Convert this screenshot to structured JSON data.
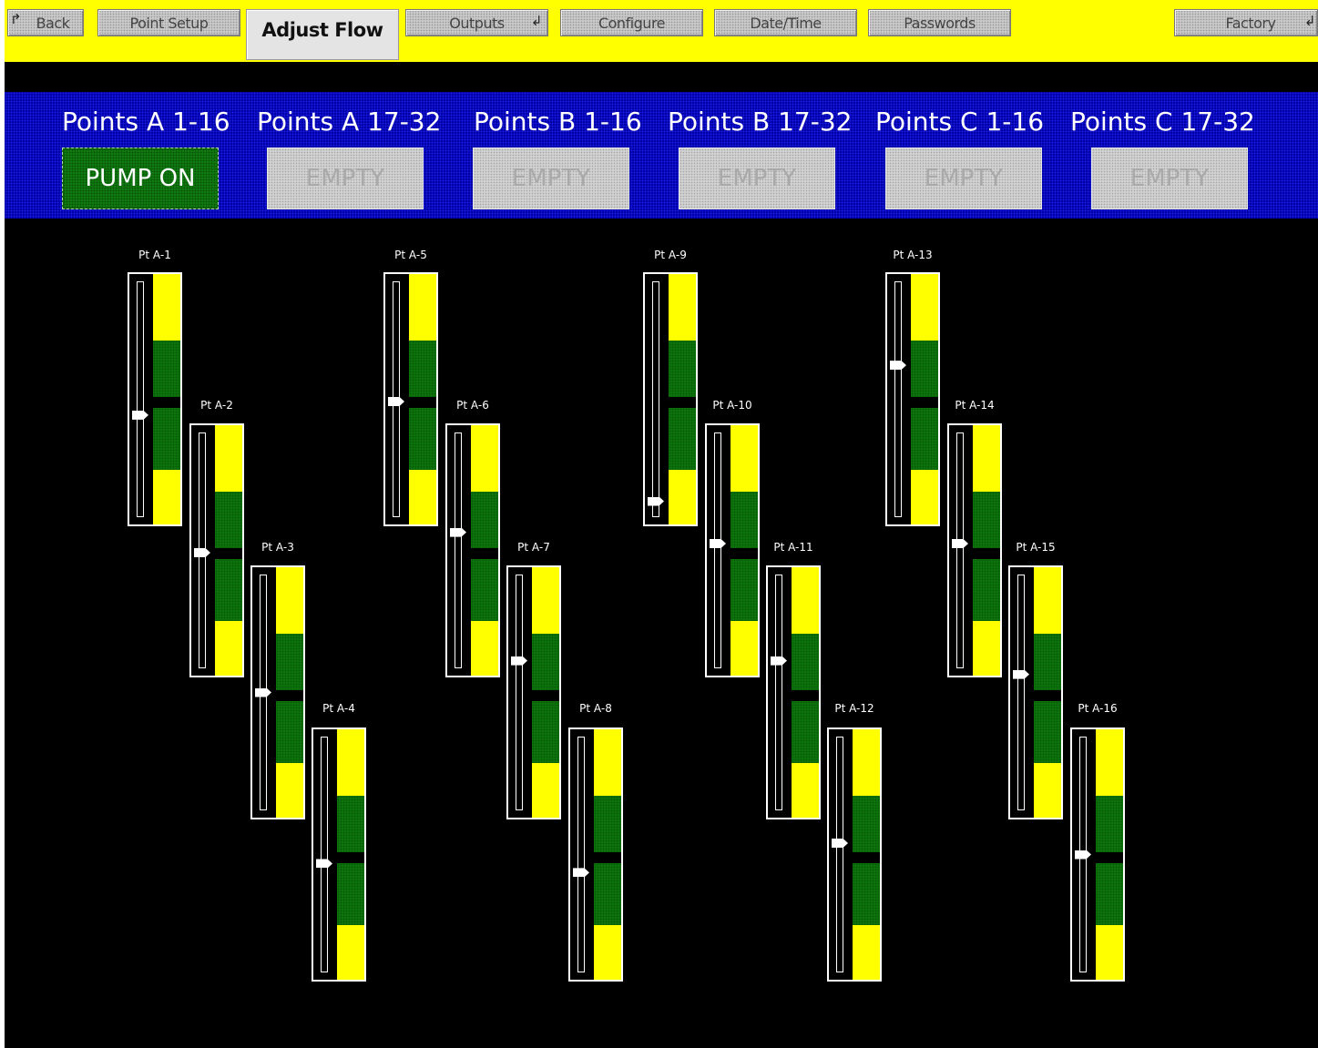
{
  "nav": {
    "back": "Back",
    "point_setup": "Point Setup",
    "adjust_flow": "Adjust Flow",
    "outputs": "Outputs",
    "configure": "Configure",
    "datetime": "Date/Time",
    "passwords": "Passwords",
    "factory": "Factory",
    "glyph_enter": "↲",
    "glyph_back": "↱"
  },
  "groups": [
    {
      "title": "Points A 1-16",
      "button": "PUMP ON",
      "state": "on"
    },
    {
      "title": "Points A 17-32",
      "button": "EMPTY",
      "state": "empty"
    },
    {
      "title": "Points B 1-16",
      "button": "EMPTY",
      "state": "empty"
    },
    {
      "title": "Points B 17-32",
      "button": "EMPTY",
      "state": "empty"
    },
    {
      "title": "Points C 1-16",
      "button": "EMPTY",
      "state": "empty"
    },
    {
      "title": "Points C 17-32",
      "button": "EMPTY",
      "state": "empty"
    }
  ],
  "points": [
    {
      "label": "Pt A-1",
      "level": 0.43
    },
    {
      "label": "Pt A-2",
      "level": 0.49
    },
    {
      "label": "Pt A-3",
      "level": 0.5
    },
    {
      "label": "Pt A-4",
      "level": 0.46
    },
    {
      "label": "Pt A-5",
      "level": 0.49
    },
    {
      "label": "Pt A-6",
      "level": 0.58
    },
    {
      "label": "Pt A-7",
      "level": 0.64
    },
    {
      "label": "Pt A-8",
      "level": 0.42
    },
    {
      "label": "Pt A-9",
      "level": 0.05
    },
    {
      "label": "Pt A-10",
      "level": 0.53
    },
    {
      "label": "Pt A-11",
      "level": 0.64
    },
    {
      "label": "Pt A-12",
      "level": 0.55
    },
    {
      "label": "Pt A-13",
      "level": 0.65
    },
    {
      "label": "Pt A-14",
      "level": 0.53
    },
    {
      "label": "Pt A-15",
      "level": 0.58
    },
    {
      "label": "Pt A-16",
      "level": 0.5
    }
  ],
  "colors": {
    "nav_bg": "#ffff00",
    "panel_blue": "#0000a8",
    "zone_yellow": "#ffff00",
    "zone_green": "#0b740b",
    "pump_on_green": "#107a10"
  }
}
